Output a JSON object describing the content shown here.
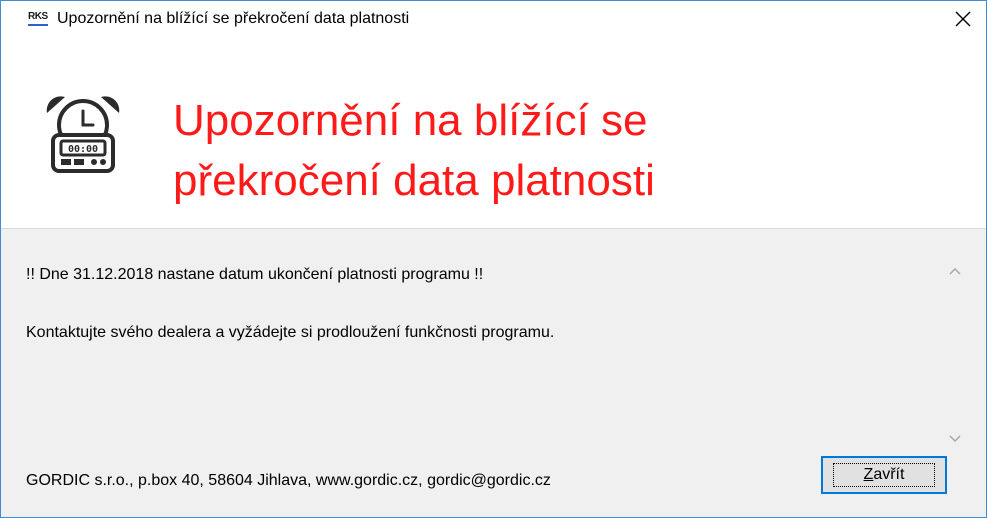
{
  "window": {
    "app_icon_text": "RKS",
    "title": "Upozornění na blížící se překročení data platnosti",
    "close_icon": "close-x-icon",
    "accent_color": "#3c8fd6"
  },
  "header": {
    "icon": "alarm-clock-icon",
    "headline_line1": "Upozornění na blížící se",
    "headline_line2": "překročení data platnosti",
    "headline_color": "#ff1a1a",
    "clock_display": "00:00"
  },
  "message": {
    "line1": "!! Dne 31.12.2018 nastane datum ukončení platnosti programu !!",
    "line2": "Kontaktujte svého dealera a vyžádejte si prodloužení funkčnosti programu."
  },
  "footer": {
    "company_info": "GORDIC s.r.o., p.box 40, 58604 Jihlava, www.gordic.cz, gordic@gordic.cz",
    "close_button_mnemonic": "Z",
    "close_button_rest": "avřít"
  }
}
